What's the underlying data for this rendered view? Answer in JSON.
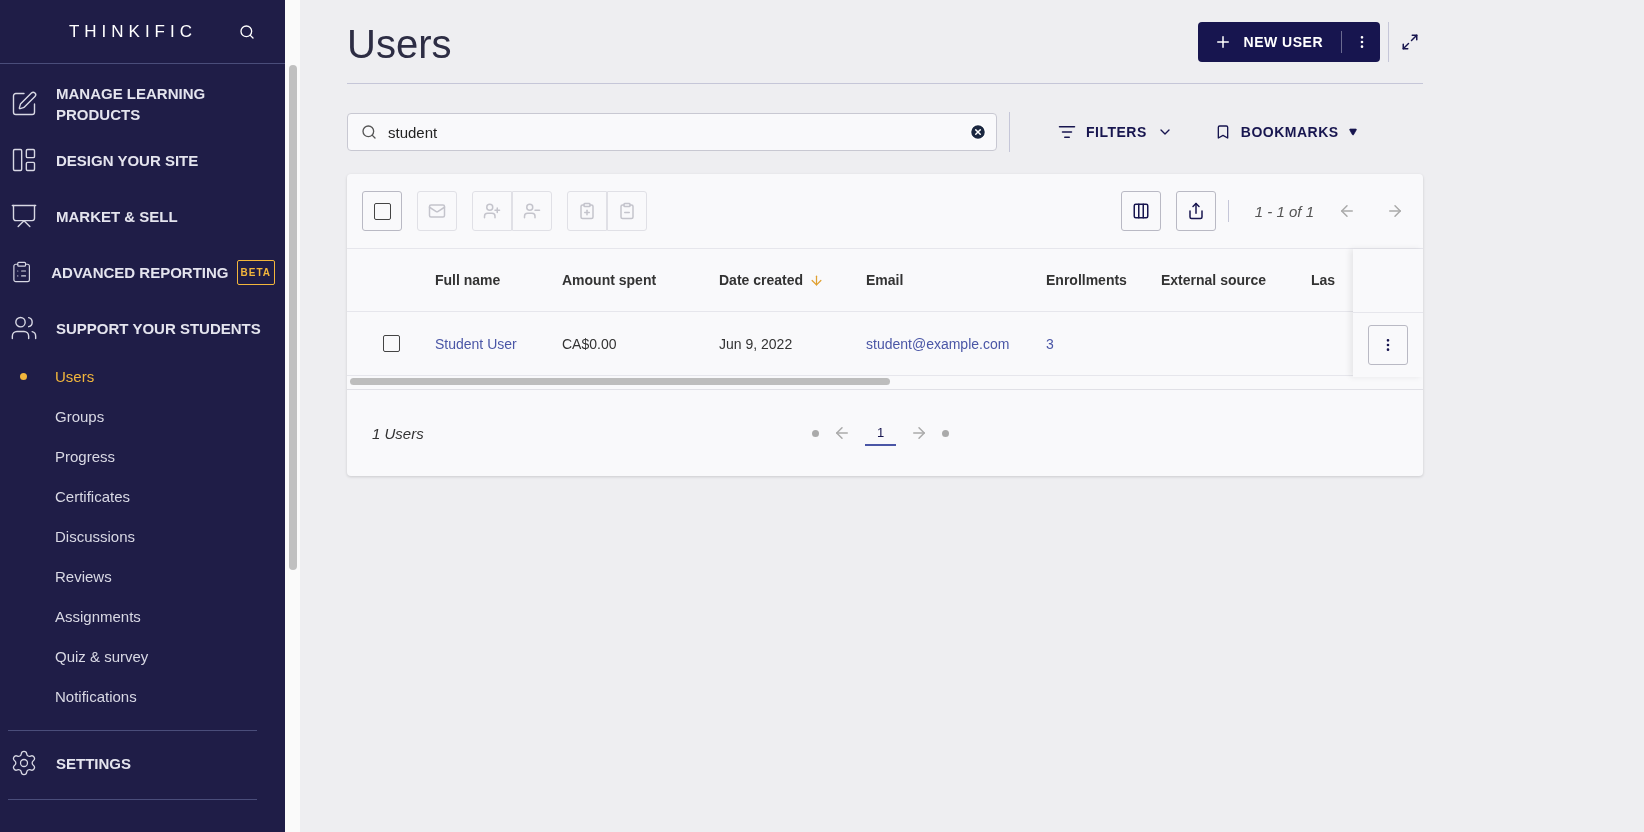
{
  "sidebar": {
    "logo": "THINKIFIC",
    "sections": [
      {
        "label": "MANAGE LEARNING PRODUCTS"
      },
      {
        "label": "DESIGN YOUR SITE"
      },
      {
        "label": "MARKET & SELL"
      },
      {
        "label": "ADVANCED REPORTING",
        "badge": "BETA"
      },
      {
        "label": "SUPPORT YOUR STUDENTS",
        "children": [
          {
            "label": "Users",
            "selected": true
          },
          {
            "label": "Groups",
            "selected": false
          },
          {
            "label": "Progress",
            "selected": false
          },
          {
            "label": "Certificates",
            "selected": false
          },
          {
            "label": "Discussions",
            "selected": false
          },
          {
            "label": "Reviews",
            "selected": false
          },
          {
            "label": "Assignments",
            "selected": false
          },
          {
            "label": "Quiz & survey",
            "selected": false
          },
          {
            "label": "Notifications",
            "selected": false
          }
        ]
      }
    ],
    "settings": {
      "label": "SETTINGS"
    }
  },
  "header": {
    "title": "Users",
    "new_button": "NEW USER"
  },
  "search": {
    "value": "student"
  },
  "filters": "FILTERS",
  "bookmarks": "BOOKMARKS",
  "toolbar": {
    "select_all_checked": false,
    "bulk_actions_disabled": true,
    "range": "1 - 1 of 1",
    "prev_disabled": true,
    "next_disabled": true
  },
  "table": {
    "columns": [
      {
        "label": "Full name",
        "sorted": false
      },
      {
        "label": "Amount spent",
        "sorted": false
      },
      {
        "label": "Date created",
        "sorted": true
      },
      {
        "label": "Email",
        "sorted": false
      },
      {
        "label": "Enrollments",
        "sorted": false
      },
      {
        "label": "External source",
        "sorted": false
      },
      {
        "label": "Las",
        "sorted": false
      }
    ],
    "rows": [
      {
        "checked": false,
        "full_name": "Student User",
        "amount_spent": "CA$0.00",
        "date_created": "Jun 9, 2022",
        "email": "student@example.com",
        "enrollments": "3"
      }
    ]
  },
  "footer": {
    "count": "1 Users",
    "pages": [
      {
        "label": "1",
        "selected": true
      }
    ]
  }
}
